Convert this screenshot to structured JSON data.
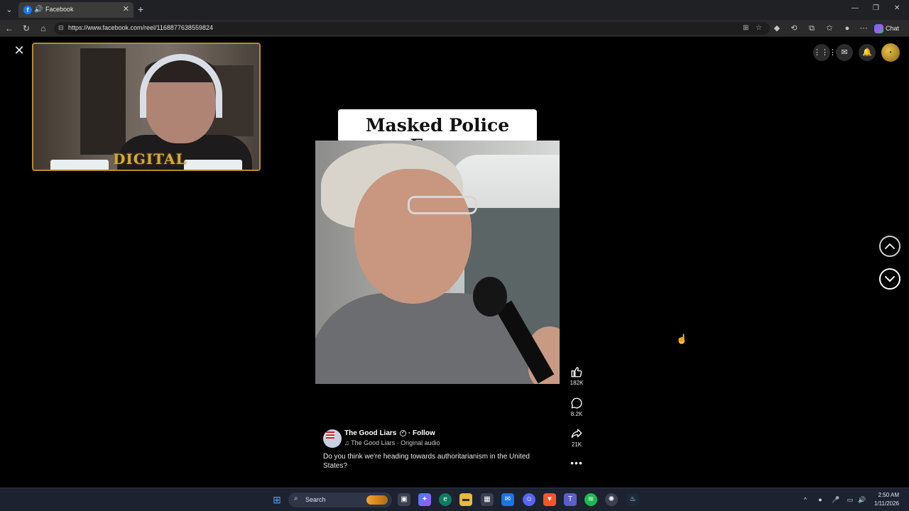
{
  "browser": {
    "tab_title": "Facebook",
    "url": "https://www.facebook.com/reel/1168877638559824",
    "chat_label": "Chat"
  },
  "reel": {
    "title": "Masked Police Force",
    "likes": "182K",
    "comments": "8.2K",
    "shares": "21K",
    "author": "The Good Liars",
    "follow_label": "Follow",
    "audio": "The Good Liars · Original audio",
    "caption": "Do you think we're heading towards authoritarianism in the United States?"
  },
  "webcam": {
    "logo_text": "DIGITAL"
  },
  "taskbar": {
    "search_label": "Search",
    "time": "2:50 AM",
    "date": "1/11/2026"
  },
  "colors": {
    "webcam_border": "#b48a2c",
    "facebook_blue": "#1877f2",
    "cursor": "#f1c40f"
  }
}
